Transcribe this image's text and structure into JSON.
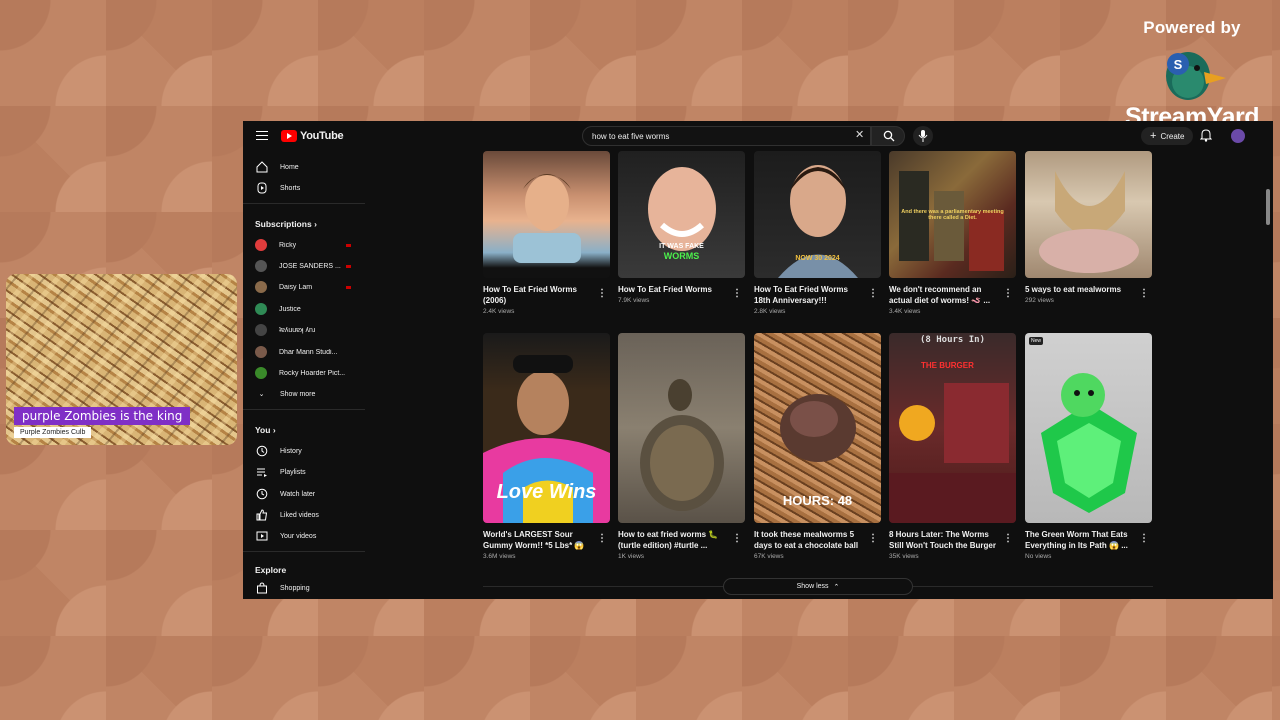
{
  "branding": {
    "powered_by": "Powered by",
    "name": "StreamYard"
  },
  "webcam": {
    "banner": "purple Zombies is the king",
    "subtitle": "Purple Zombies Culb"
  },
  "youtube": {
    "logo_text": "YouTube",
    "search": {
      "value": "how to eat five worms"
    },
    "create_label": "Create",
    "sidebar": {
      "home": "Home",
      "shorts": "Shorts",
      "subscriptions_header": "Subscriptions",
      "subscriptions": [
        {
          "name": "Ricky",
          "color": "#e03c3c",
          "live": true
        },
        {
          "name": "JOSE SANDERS ...",
          "color": "#555555",
          "live": true
        },
        {
          "name": "Daisy Lam",
          "color": "#8a6a4a",
          "live": true
        },
        {
          "name": "Justice",
          "color": "#2f8a55",
          "live": false
        },
        {
          "name": "ʇɐʎuuɐʞ ʎnɹ",
          "color": "#444444",
          "live": false
        },
        {
          "name": "Dhar Mann Studi...",
          "color": "#7a5a4a",
          "live": false
        },
        {
          "name": "Rocky Hoarder Pict...",
          "color": "#3a8a2a",
          "live": false
        }
      ],
      "show_more": "Show more",
      "you_header": "You",
      "you_items": [
        "History",
        "Playlists",
        "Watch later",
        "Liked videos",
        "Your videos"
      ],
      "explore_header": "Explore",
      "explore_items": [
        "Shopping"
      ]
    },
    "videos_row1": [
      {
        "title": "How To Eat Fried Worms (2006)",
        "views": "2.4K views",
        "thumb_text": ""
      },
      {
        "title": "How To Eat Fried Worms",
        "views": "7.9K views",
        "thumb_text": "IT WAS FAKE",
        "thumb_text2": "WORMS"
      },
      {
        "title": "How To Eat Fried Worms 18th Anniversary!!!",
        "views": "2.8K views",
        "thumb_text": "NOW 30 2024"
      },
      {
        "title": "We don't recommend an actual diet of worms! 🪱 ...",
        "views": "3.4K views",
        "thumb_text": "And there was a parliamentary meeting there called a Diet."
      },
      {
        "title": "5 ways to eat mealworms",
        "views": "292 views",
        "thumb_text": ""
      }
    ],
    "videos_row2": [
      {
        "title": "World's LARGEST Sour Gummy Worm!! *5 Lbs* 😱",
        "views": "3.6M views",
        "thumb_text": "Love Wins"
      },
      {
        "title": "How to eat fried worms 🐛 (turtle edition) #turtle ...",
        "views": "1K views",
        "thumb_text": ""
      },
      {
        "title": "It took these mealworms 5 days to eat a chocolate ball",
        "views": "67K views",
        "thumb_text": "HOURS: 48"
      },
      {
        "title": "8 Hours Later: The Worms Still Won't Touch the Burger",
        "views": "35K views",
        "thumb_text": "(8 Hours In)",
        "thumb_text2": "THE BURGER"
      },
      {
        "title": "The Green Worm That Eats Everything in Its Path 😱 ...",
        "views": "No views",
        "thumb_text": "New"
      }
    ],
    "show_less": "Show less"
  }
}
